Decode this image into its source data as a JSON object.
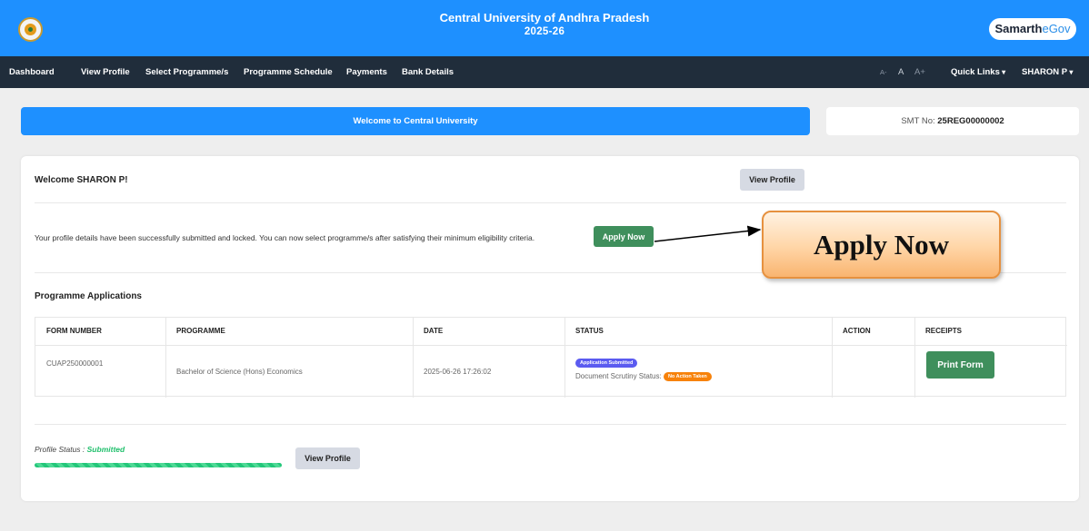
{
  "header": {
    "university": "Central University of Andhra Pradesh",
    "year": "2025-26",
    "brand_bold": "Samarth",
    "brand_light": "eGov"
  },
  "nav": {
    "items": [
      "Dashboard",
      "View Profile",
      "Select Programme/s",
      "Programme Schedule",
      "Payments",
      "Bank Details"
    ],
    "font_small": "A-",
    "font_normal": "A",
    "font_large": "A+",
    "quick_links": "Quick Links",
    "user": "SHARON P"
  },
  "welcome_banner": "Welcome to Central University",
  "smt": {
    "label": "SMT No: ",
    "value": "25REG00000002"
  },
  "card": {
    "welcome_user": "Welcome SHARON P!",
    "view_profile_btn": "View Profile",
    "profile_message": "Your profile details have been successfully submitted and locked. You can now select programme/s after satisfying their minimum eligibility criteria.",
    "apply_now_btn": "Apply Now",
    "section_title": "Programme Applications",
    "table": {
      "headers": [
        "FORM NUMBER",
        "PROGRAMME",
        "DATE",
        "STATUS",
        "ACTION",
        "RECEIPTS"
      ],
      "rows": [
        {
          "form_number": "CUAP250000001",
          "programme": "Bachelor of Science (Hons) Economics",
          "date": "2025-06-26 17:26:02",
          "status_badge": "Application Submitted",
          "scrutiny_label": "Document Scrutiny Status:",
          "scrutiny_badge": "No Action Taken",
          "action": "",
          "receipt_btn": "Print Form"
        }
      ]
    },
    "profile_status_label": "Profile Status : ",
    "profile_status_value": "Submitted",
    "profile_progress": 1.0,
    "view_profile_btn2": "View Profile"
  },
  "callout": {
    "text": "Apply Now"
  },
  "colors": {
    "header_blue": "#1e90ff",
    "navbar": "#202d3b",
    "apply_green": "#3f8f5c",
    "badge_purple": "#5b5bf0",
    "badge_orange": "#f7820a",
    "status_green": "#1fbf6b"
  },
  "icons": {
    "logo": "university-emblem-icon",
    "dropdown": "caret-down-icon"
  }
}
